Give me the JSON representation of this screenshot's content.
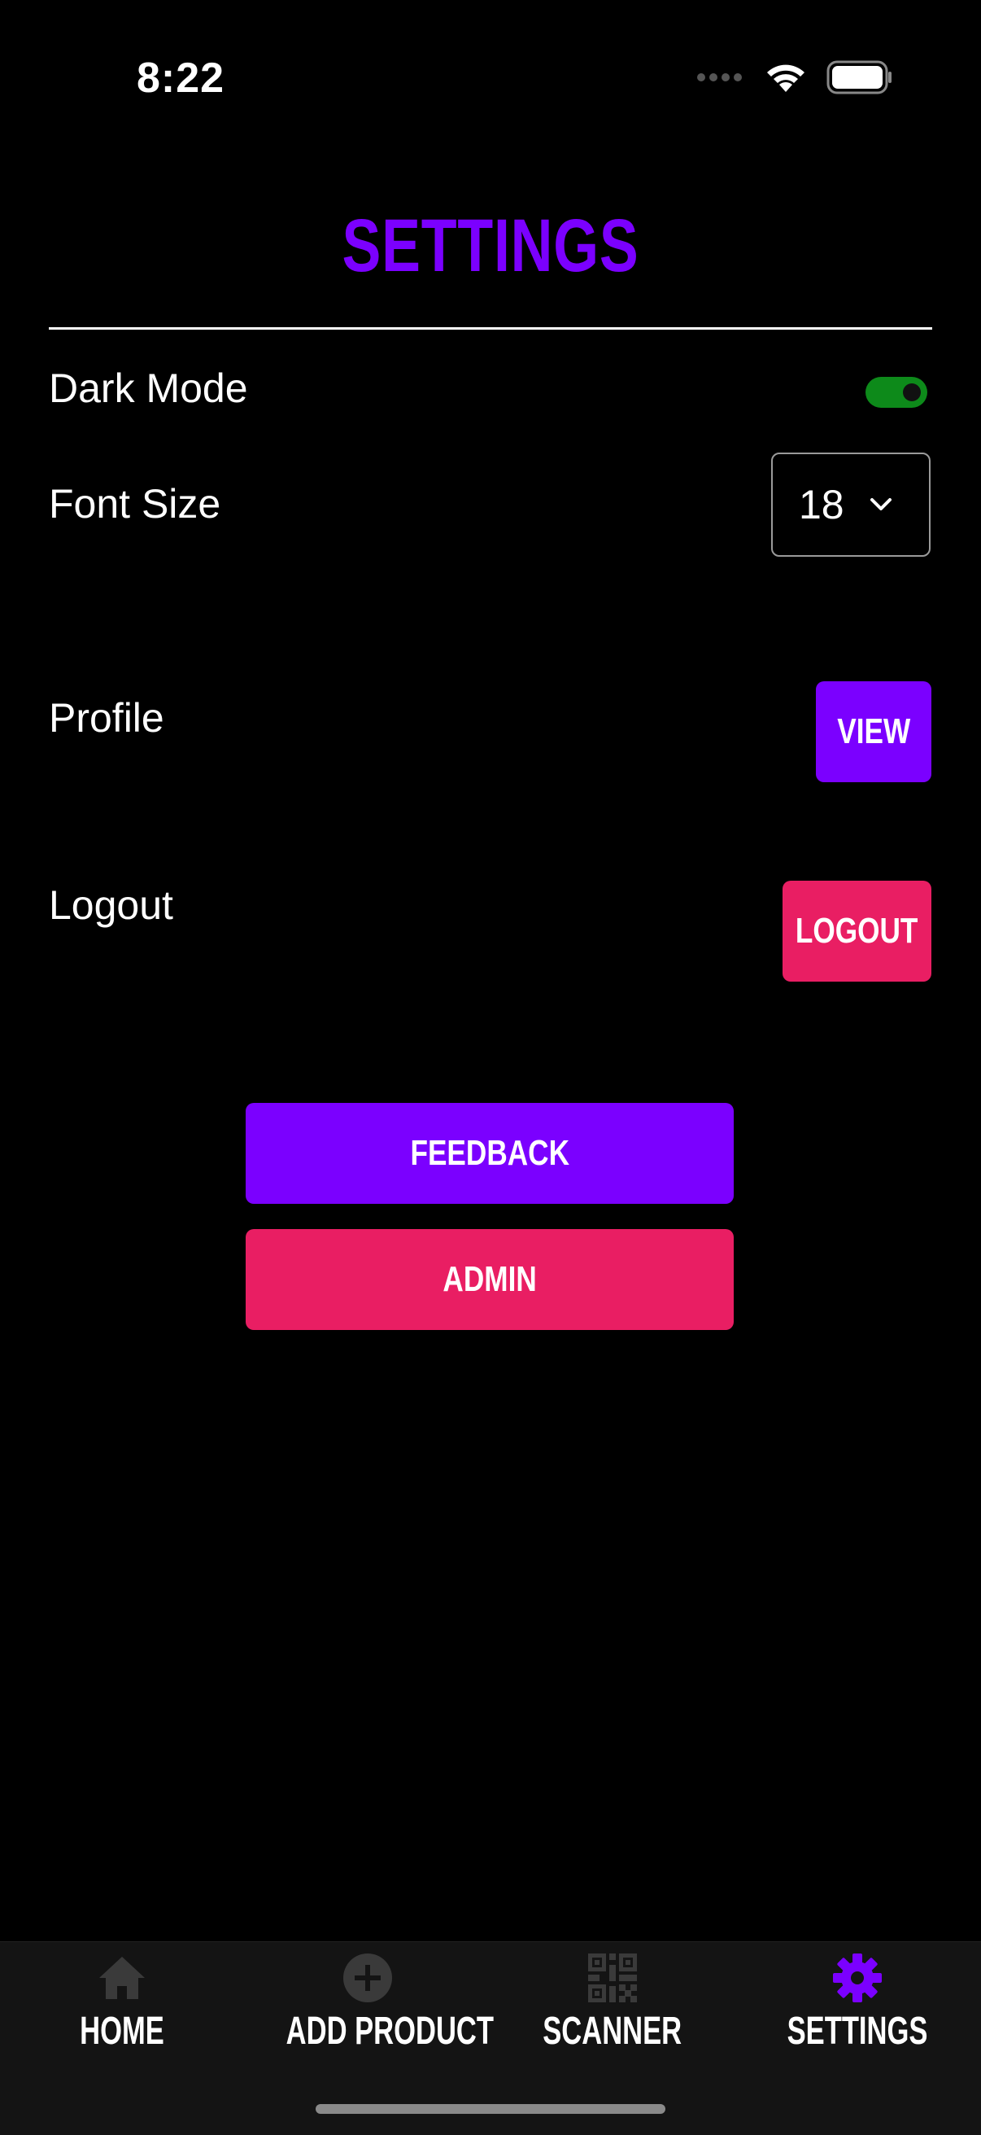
{
  "status_bar": {
    "time": "8:22",
    "icons": [
      "signal-dots-icon",
      "wifi-icon",
      "battery-icon"
    ]
  },
  "page": {
    "title": "SETTINGS",
    "accent_color": "#7b00ff",
    "danger_color": "#e91e63"
  },
  "settings": {
    "dark_mode": {
      "label": "Dark Mode",
      "enabled": true,
      "toggle_color": "#0d8a1a"
    },
    "font_size": {
      "label": "Font Size",
      "value": "18"
    },
    "profile": {
      "label": "Profile",
      "button": "VIEW"
    },
    "logout": {
      "label": "Logout",
      "button": "LOGOUT"
    }
  },
  "actions": {
    "feedback": "FEEDBACK",
    "admin": "ADMIN"
  },
  "tabbar": {
    "tabs": [
      {
        "label": "HOME",
        "icon": "home-icon",
        "active": false
      },
      {
        "label": "ADD PRODUCT",
        "icon": "add-circle-icon",
        "active": false
      },
      {
        "label": "SCANNER",
        "icon": "qr-code-icon",
        "active": false
      },
      {
        "label": "SETTINGS",
        "icon": "gear-icon",
        "active": true
      }
    ],
    "inactive_icon_color": "#3a3a3a",
    "active_icon_color": "#7b00ff"
  }
}
